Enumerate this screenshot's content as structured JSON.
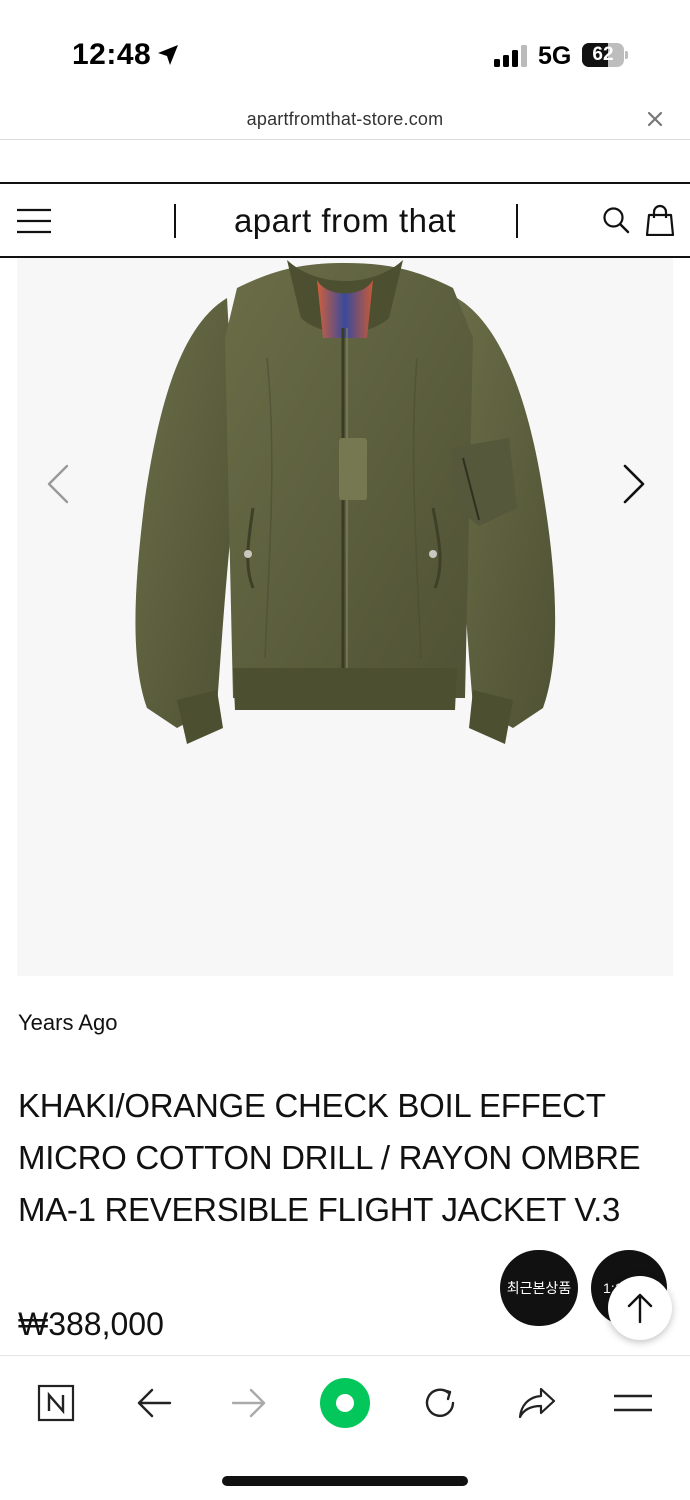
{
  "status_bar": {
    "time": "12:48",
    "network": "5G",
    "battery_percent": "62",
    "battery_level": 0.62
  },
  "browser": {
    "url": "apartfromthat-store.com",
    "close_icon": "close-icon"
  },
  "site_header": {
    "brand": "apart from that",
    "menu_icon": "hamburger-menu-icon",
    "search_icon": "search-icon",
    "cart_icon": "shopping-bag-icon"
  },
  "gallery": {
    "prev_icon": "chevron-left-icon",
    "next_icon": "chevron-right-icon"
  },
  "product": {
    "brand": "Years Ago",
    "title": "KHAKI/ORANGE CHECK BOIL EFFECT MICRO COTTON DRILL / RAYON OMBRE MA-1 REVERSIBLE FLIGHT JACKET V.3",
    "price": "₩388,000"
  },
  "floating": {
    "recent_label": "최근본상품",
    "chat_label": "1:1",
    "scroll_top_icon": "arrow-up-icon"
  },
  "toolbar": {
    "items": [
      "naver-n-icon",
      "back-arrow-icon",
      "forward-arrow-icon",
      "green-dot-icon",
      "reload-icon",
      "share-icon",
      "menu-icon"
    ]
  },
  "colors": {
    "jacket": "#5b5e3c",
    "accent_green": "#03c75a",
    "text": "#111111"
  }
}
